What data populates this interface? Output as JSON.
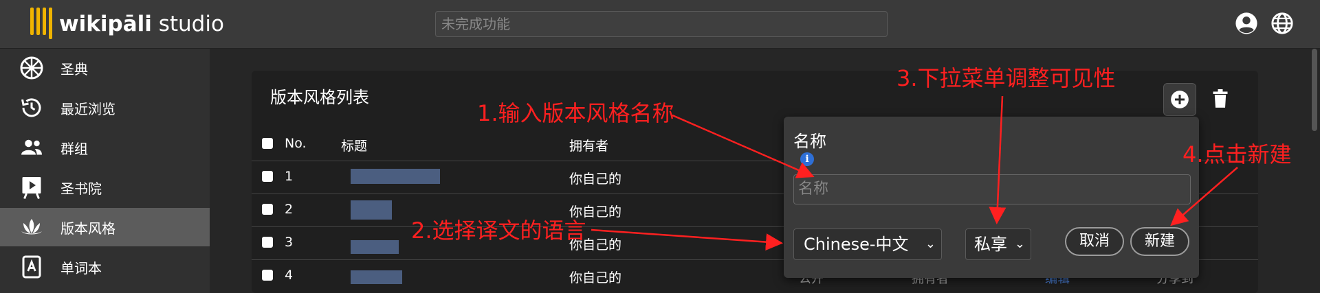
{
  "app": {
    "logo_bold": "wikipāli",
    "logo_light": " studio"
  },
  "search": {
    "placeholder": "未完成功能"
  },
  "sidebar": {
    "items": [
      {
        "label": "圣典",
        "icon": "dharma-wheel-icon"
      },
      {
        "label": "最近浏览",
        "icon": "history-icon"
      },
      {
        "label": "群组",
        "icon": "group-icon"
      },
      {
        "label": "圣书院",
        "icon": "course-icon"
      },
      {
        "label": "版本风格",
        "icon": "lotus-icon"
      },
      {
        "label": "单词本",
        "icon": "dictionary-icon"
      }
    ],
    "active_index": 4
  },
  "card": {
    "title": "版本风格列表",
    "columns": {
      "no": "No.",
      "title": "标题",
      "owner": "拥有者"
    },
    "rows": [
      {
        "no": "1",
        "owner": "你自己的"
      },
      {
        "no": "2",
        "owner": "你自己的"
      },
      {
        "no": "3",
        "owner": "你自己的"
      },
      {
        "no": "4",
        "owner": "你自己的",
        "privacy": "公开",
        "role": "拥有者",
        "edit": "编辑",
        "share": "分享到"
      }
    ]
  },
  "popup": {
    "name_label": "名称",
    "name_placeholder": "名称",
    "language_value": "Chinese-中文",
    "privacy_value": "私享",
    "cancel": "取消",
    "create": "新建"
  },
  "annotations": {
    "step1": "1.输入版本风格名称",
    "step2": "2.选择译文的语言",
    "step3": "3.下拉菜单调整可见性",
    "step4": "4.点击新建"
  },
  "colors": {
    "annotation": "#ff2020",
    "accent": "#f0b400",
    "info": "#2e6fd6"
  }
}
